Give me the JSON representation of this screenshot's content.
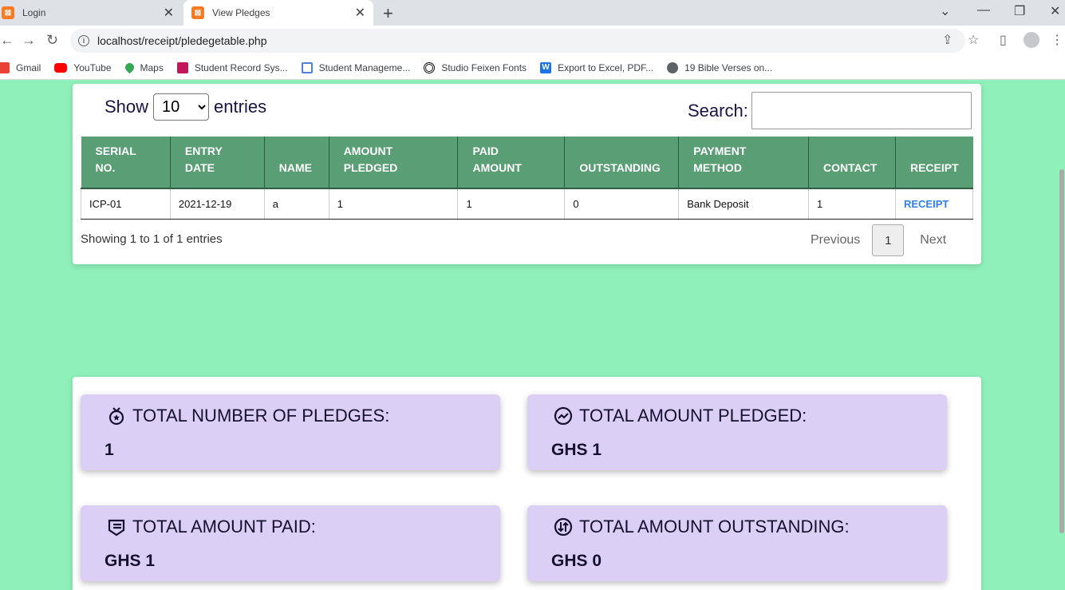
{
  "browser": {
    "tabs": [
      {
        "label": "Login"
      },
      {
        "label": "View Pledges"
      }
    ],
    "url": "localhost/receipt/pledegetable.php",
    "bookmarks": [
      {
        "label": "Gmail",
        "color": "#ea4335"
      },
      {
        "label": "YouTube",
        "color": "#ff0000"
      },
      {
        "label": "Maps",
        "color": "#34a853"
      },
      {
        "label": "Student Record Sys...",
        "color": "#c2185b"
      },
      {
        "label": "Student Manageme...",
        "color": "#4f7fd9"
      },
      {
        "label": "Studio Feixen Fonts",
        "color": "#111111"
      },
      {
        "label": "Export to Excel, PDF...",
        "color": "#1a73e8"
      },
      {
        "label": "19 Bible Verses on...",
        "color": "#5f6368"
      }
    ]
  },
  "table_controls": {
    "show_label": "Show",
    "entries_value": "10",
    "entries_label": "entries",
    "search_label": "Search:"
  },
  "table": {
    "headers": [
      [
        "SERIAL",
        "NO."
      ],
      [
        "ENTRY",
        "DATE"
      ],
      [
        "",
        "NAME"
      ],
      [
        "AMOUNT",
        "PLEDGED"
      ],
      [
        "PAID",
        "AMOUNT"
      ],
      [
        "",
        "OUTSTANDING"
      ],
      [
        "PAYMENT",
        "METHOD"
      ],
      [
        "",
        "CONTACT"
      ],
      [
        "",
        "RECEIPT"
      ]
    ],
    "rows": [
      [
        "ICP-01",
        "2021-12-19",
        "a",
        "1",
        "1",
        "0",
        "Bank Deposit",
        "1",
        "RECEIPT"
      ]
    ],
    "info": "Showing 1 to 1 of 1 entries",
    "pager": {
      "previous": "Previous",
      "current": "1",
      "next": "Next"
    }
  },
  "stats": [
    {
      "label": "TOTAL NUMBER OF PLEDGES:",
      "value": "1",
      "icon": "medal-icon"
    },
    {
      "label": "TOTAL AMOUNT PLEDGED:",
      "value": "GHS 1",
      "icon": "trend-icon"
    },
    {
      "label": "TOTAL AMOUNT PAID:",
      "value": "GHS 1",
      "icon": "cash-icon"
    },
    {
      "label": "TOTAL AMOUNT OUTSTANDING:",
      "value": "GHS 0",
      "icon": "exchange-icon"
    }
  ],
  "colors": {
    "page_bg": "#8ff0b9",
    "table_header": "#5a9e75",
    "stat_card": "#dccff6",
    "link": "#2f80ed"
  }
}
